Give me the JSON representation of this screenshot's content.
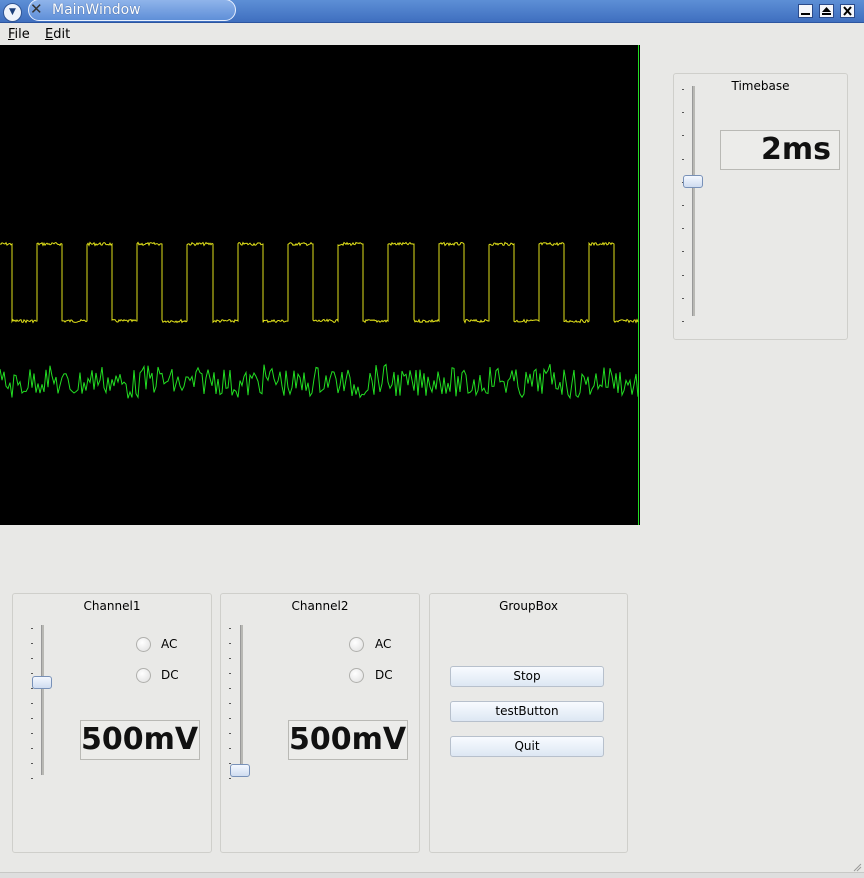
{
  "window": {
    "title": "MainWindow",
    "app_icon": "x-icon",
    "controls": [
      "minimize-icon",
      "maximize-icon",
      "close-icon"
    ]
  },
  "menubar": {
    "items": [
      {
        "label": "File",
        "mnemonic": "F",
        "rest": "ile"
      },
      {
        "label": "Edit",
        "mnemonic": "E",
        "rest": "dit"
      }
    ]
  },
  "scope": {
    "background": "#000000",
    "channel1_color": "#e0e01a",
    "channel2_color": "#22dd22",
    "square_wave_periods": 12.7
  },
  "timebase": {
    "title": "Timebase",
    "value": "2ms",
    "slider_level": 0.42
  },
  "channel1": {
    "title": "Channel1",
    "ac_label": "AC",
    "dc_label": "DC",
    "value": "500mV",
    "slider_level": 0.62
  },
  "channel2": {
    "title": "Channel2",
    "ac_label": "AC",
    "dc_label": "DC",
    "value": "500mV",
    "slider_level": 0.0
  },
  "groupbox": {
    "title": "GroupBox",
    "buttons": [
      "Stop",
      "testButton",
      "Quit"
    ]
  }
}
